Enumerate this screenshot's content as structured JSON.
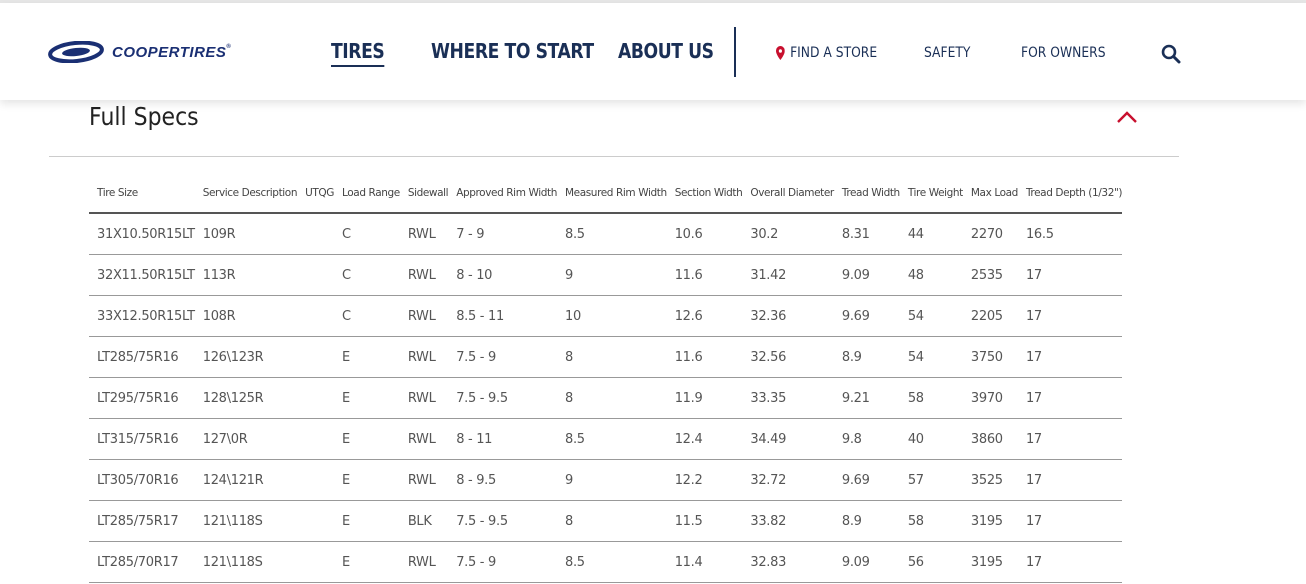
{
  "header": {
    "logo_text": "COOPERTIRES",
    "logo_reg": "®",
    "nav_main": [
      "TIRES",
      "WHERE TO START",
      "ABOUT US"
    ],
    "nav_secondary": [
      "FIND A STORE",
      "SAFETY",
      "FOR OWNERS"
    ],
    "active_nav": "TIRES",
    "icons": {
      "store": "location-pin-icon",
      "search": "search-icon",
      "collapse": "chevron-up-icon"
    }
  },
  "section": {
    "title": "Full Specs"
  },
  "table": {
    "columns": [
      "Tire Size",
      "Service Description",
      "UTQG",
      "Load Range",
      "Sidewall",
      "Approved Rim Width",
      "Measured Rim Width",
      "Section Width",
      "Overall Diameter",
      "Tread Width",
      "Tire Weight",
      "Max Load",
      "Tread Depth (1/32\")"
    ],
    "rows": [
      [
        "31X10.50R15LT",
        "109R",
        "",
        "C",
        "RWL",
        "7 - 9",
        "8.5",
        "10.6",
        "30.2",
        "8.31",
        "44",
        "2270",
        "16.5"
      ],
      [
        "32X11.50R15LT",
        "113R",
        "",
        "C",
        "RWL",
        "8 - 10",
        "9",
        "11.6",
        "31.42",
        "9.09",
        "48",
        "2535",
        "17"
      ],
      [
        "33X12.50R15LT",
        "108R",
        "",
        "C",
        "RWL",
        "8.5 - 11",
        "10",
        "12.6",
        "32.36",
        "9.69",
        "54",
        "2205",
        "17"
      ],
      [
        "LT285/75R16",
        "126\\123R",
        "",
        "E",
        "RWL",
        "7.5 - 9",
        "8",
        "11.6",
        "32.56",
        "8.9",
        "54",
        "3750",
        "17"
      ],
      [
        "LT295/75R16",
        "128\\125R",
        "",
        "E",
        "RWL",
        "7.5 - 9.5",
        "8",
        "11.9",
        "33.35",
        "9.21",
        "58",
        "3970",
        "17"
      ],
      [
        "LT315/75R16",
        "127\\0R",
        "",
        "E",
        "RWL",
        "8 - 11",
        "8.5",
        "12.4",
        "34.49",
        "9.8",
        "40",
        "3860",
        "17"
      ],
      [
        "LT305/70R16",
        "124\\121R",
        "",
        "E",
        "RWL",
        "8 - 9.5",
        "9",
        "12.2",
        "32.72",
        "9.69",
        "57",
        "3525",
        "17"
      ],
      [
        "LT285/75R17",
        "121\\118S",
        "",
        "E",
        "BLK",
        "7.5 - 9.5",
        "8",
        "11.5",
        "33.82",
        "8.9",
        "58",
        "3195",
        "17"
      ],
      [
        "LT285/70R17",
        "121\\118S",
        "",
        "E",
        "RWL",
        "7.5 - 9",
        "8.5",
        "11.4",
        "32.83",
        "9.09",
        "56",
        "3195",
        "17"
      ]
    ],
    "highlighted": [
      [
        5,
        7
      ],
      [
        5,
        8
      ]
    ],
    "highlight_color": "#ffff33"
  },
  "colors": {
    "navy": "#1a2f56",
    "accent": "#c8102e"
  }
}
